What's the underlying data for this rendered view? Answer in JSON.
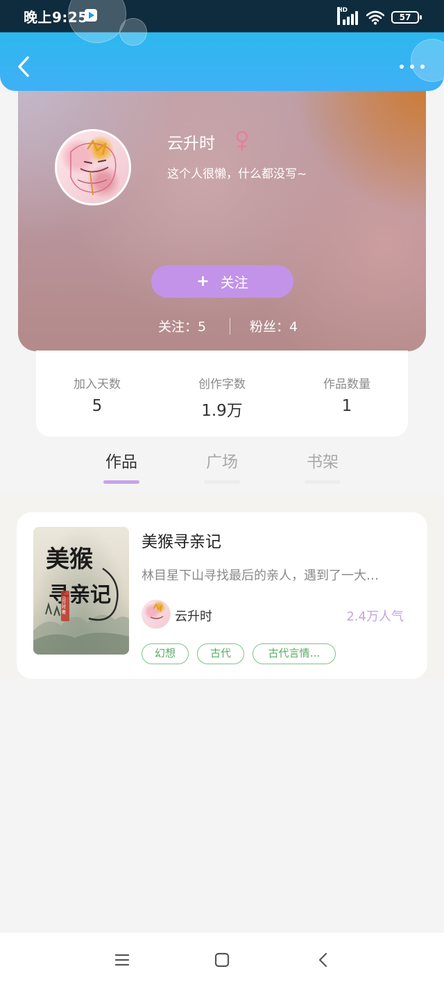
{
  "status_bar": {
    "time": "晚上9:25",
    "network_label": "HD",
    "battery": "57"
  },
  "header": {
    "back_icon": "chevron-left-icon",
    "more_icon": "more-horizontal-icon",
    "accent": "#3fb0f6"
  },
  "profile": {
    "name": "云升时",
    "gender": "female",
    "gender_color": "#e87d9c",
    "bio": "这个人很懒，什么都没写~",
    "follow_plus": "+",
    "follow_label": "关注",
    "follow_color": "#c293e8",
    "following": "关注：5",
    "fans": "粉丝：4"
  },
  "stats": [
    {
      "label": "加入天数",
      "value": "5"
    },
    {
      "label": "创作字数",
      "value": "1.9万"
    },
    {
      "label": "作品数量",
      "value": "1"
    }
  ],
  "tabs": [
    {
      "label": "作品",
      "active": true
    },
    {
      "label": "广场",
      "active": false
    },
    {
      "label": "书架",
      "active": false
    }
  ],
  "works": [
    {
      "title": "美猴寻亲记",
      "description": "林目星下山寻找最后的亲人，遇到了一大…",
      "author": "云升时",
      "popularity": "2.4万人气",
      "cover_title_top": "美猴",
      "cover_title_bottom": "寻亲记",
      "cover_seal": "云升时 著",
      "tags": [
        "幻想",
        "古代",
        "古代言情…"
      ]
    }
  ],
  "bottom_nav": {
    "menu_icon": "menu-icon",
    "home_icon": "home-square-icon",
    "back_icon": "nav-back-icon"
  }
}
